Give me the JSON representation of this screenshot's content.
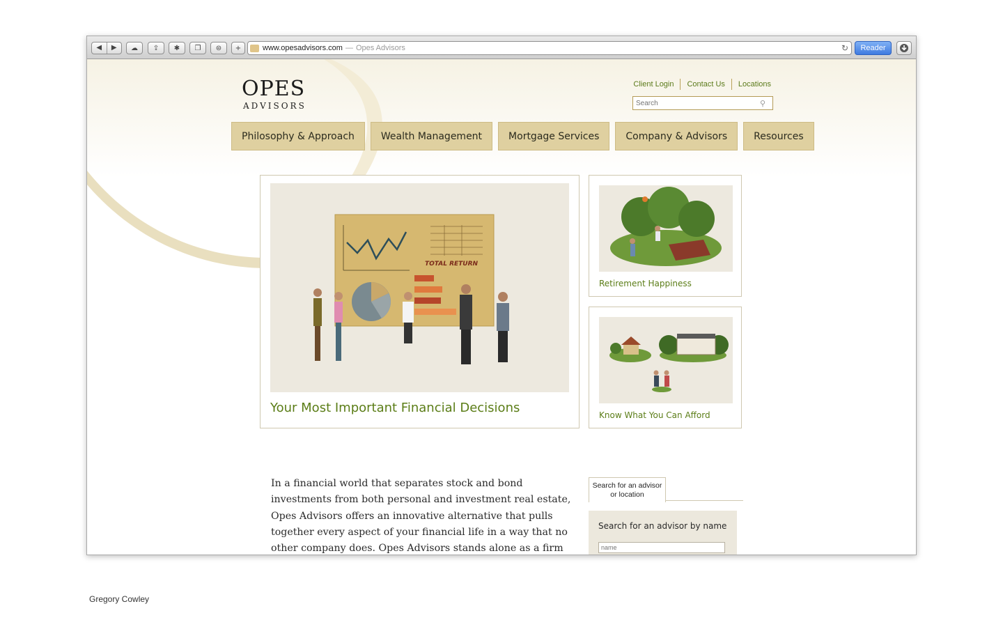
{
  "browser": {
    "url": "www.opesadvisors.com",
    "separator": "—",
    "page_title": "Opes Advisors",
    "reader_label": "Reader",
    "buttons": [
      "back-icon",
      "forward-icon",
      "icloud-icon",
      "share-icon",
      "top-sites-icon",
      "history-icon",
      "bookmarks-icon",
      "new-tab-icon",
      "reload-icon",
      "downloads-icon"
    ]
  },
  "header": {
    "logo_line1": "OPES",
    "logo_line2": "ADVISORS",
    "utility_links": [
      "Client Login",
      "Contact Us",
      "Locations"
    ],
    "search_placeholder": "Search"
  },
  "nav": {
    "items": [
      "Philosophy & Approach",
      "Wealth Management",
      "Mortgage Services",
      "Company & Advisors",
      "Resources"
    ]
  },
  "feature": {
    "caption": "Your Most Important Financial Decisions",
    "chart_label": "TOTAL RETURN"
  },
  "side_cards": [
    {
      "caption": "Retirement Happiness"
    },
    {
      "caption": "Know What You Can Afford"
    }
  ],
  "body": {
    "paragraph": "In a financial world that separates stock and bond investments from both personal and investment real estate, Opes Advisors offers an innovative alternative that pulls together every aspect of your financial life in a way that no other company does. Opes Advisors stands alone as a firm that brings together wealth"
  },
  "advisor_search": {
    "tab_label": "Search for an advisor or location",
    "panel_title": "Search for an advisor by name",
    "name_placeholder": "name"
  },
  "credit": "Gregory Cowley",
  "colors": {
    "accent_green": "#5b7d17",
    "nav_tan": "#dfd0a0",
    "reader_blue": "#3f7ae0"
  }
}
